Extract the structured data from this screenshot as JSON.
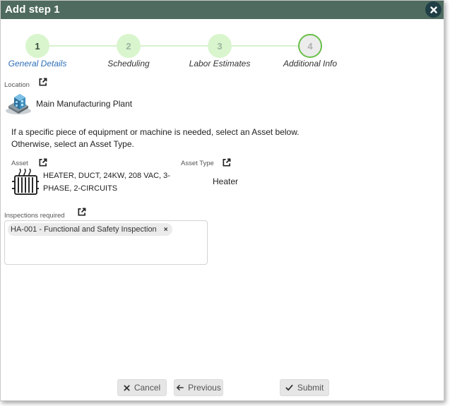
{
  "dialog": {
    "title": "Add step 1"
  },
  "stepper": {
    "steps": [
      {
        "number": "1",
        "label": "General Details",
        "state": "active"
      },
      {
        "number": "2",
        "label": "Scheduling",
        "state": "upcoming"
      },
      {
        "number": "3",
        "label": "Labor Estimates",
        "state": "upcoming"
      },
      {
        "number": "4",
        "label": "Additional Info",
        "state": "current"
      }
    ]
  },
  "location": {
    "label": "Location",
    "value": "Main Manufacturing Plant",
    "icon": "building-icon"
  },
  "instructions": {
    "line1": "If a specific piece of equipment or machine is needed, select an Asset below.",
    "line2": "Otherwise, select an Asset Type."
  },
  "asset": {
    "label": "Asset",
    "value_line1": "HEATER, DUCT, 24KW, 208 VAC, 3-",
    "value_line2": "PHASE, 2-CIRCUITS",
    "icon": "radiator-icon"
  },
  "asset_type": {
    "label": "Asset Type",
    "value": "Heater"
  },
  "inspections": {
    "label": "Inspections required",
    "chips": [
      "HA-001 - Functional and Safety Inspection"
    ],
    "remove_symbol": "×"
  },
  "footer": {
    "cancel_label": "Cancel",
    "previous_label": "Previous",
    "submit_label": "Submit"
  },
  "colors": {
    "titlebar": "#4f6b5f",
    "close_button": "#1f3e46",
    "step_fill": "#d9f5cd",
    "step_current_border": "#68c048",
    "active_step_label": "#2f6fb8"
  }
}
